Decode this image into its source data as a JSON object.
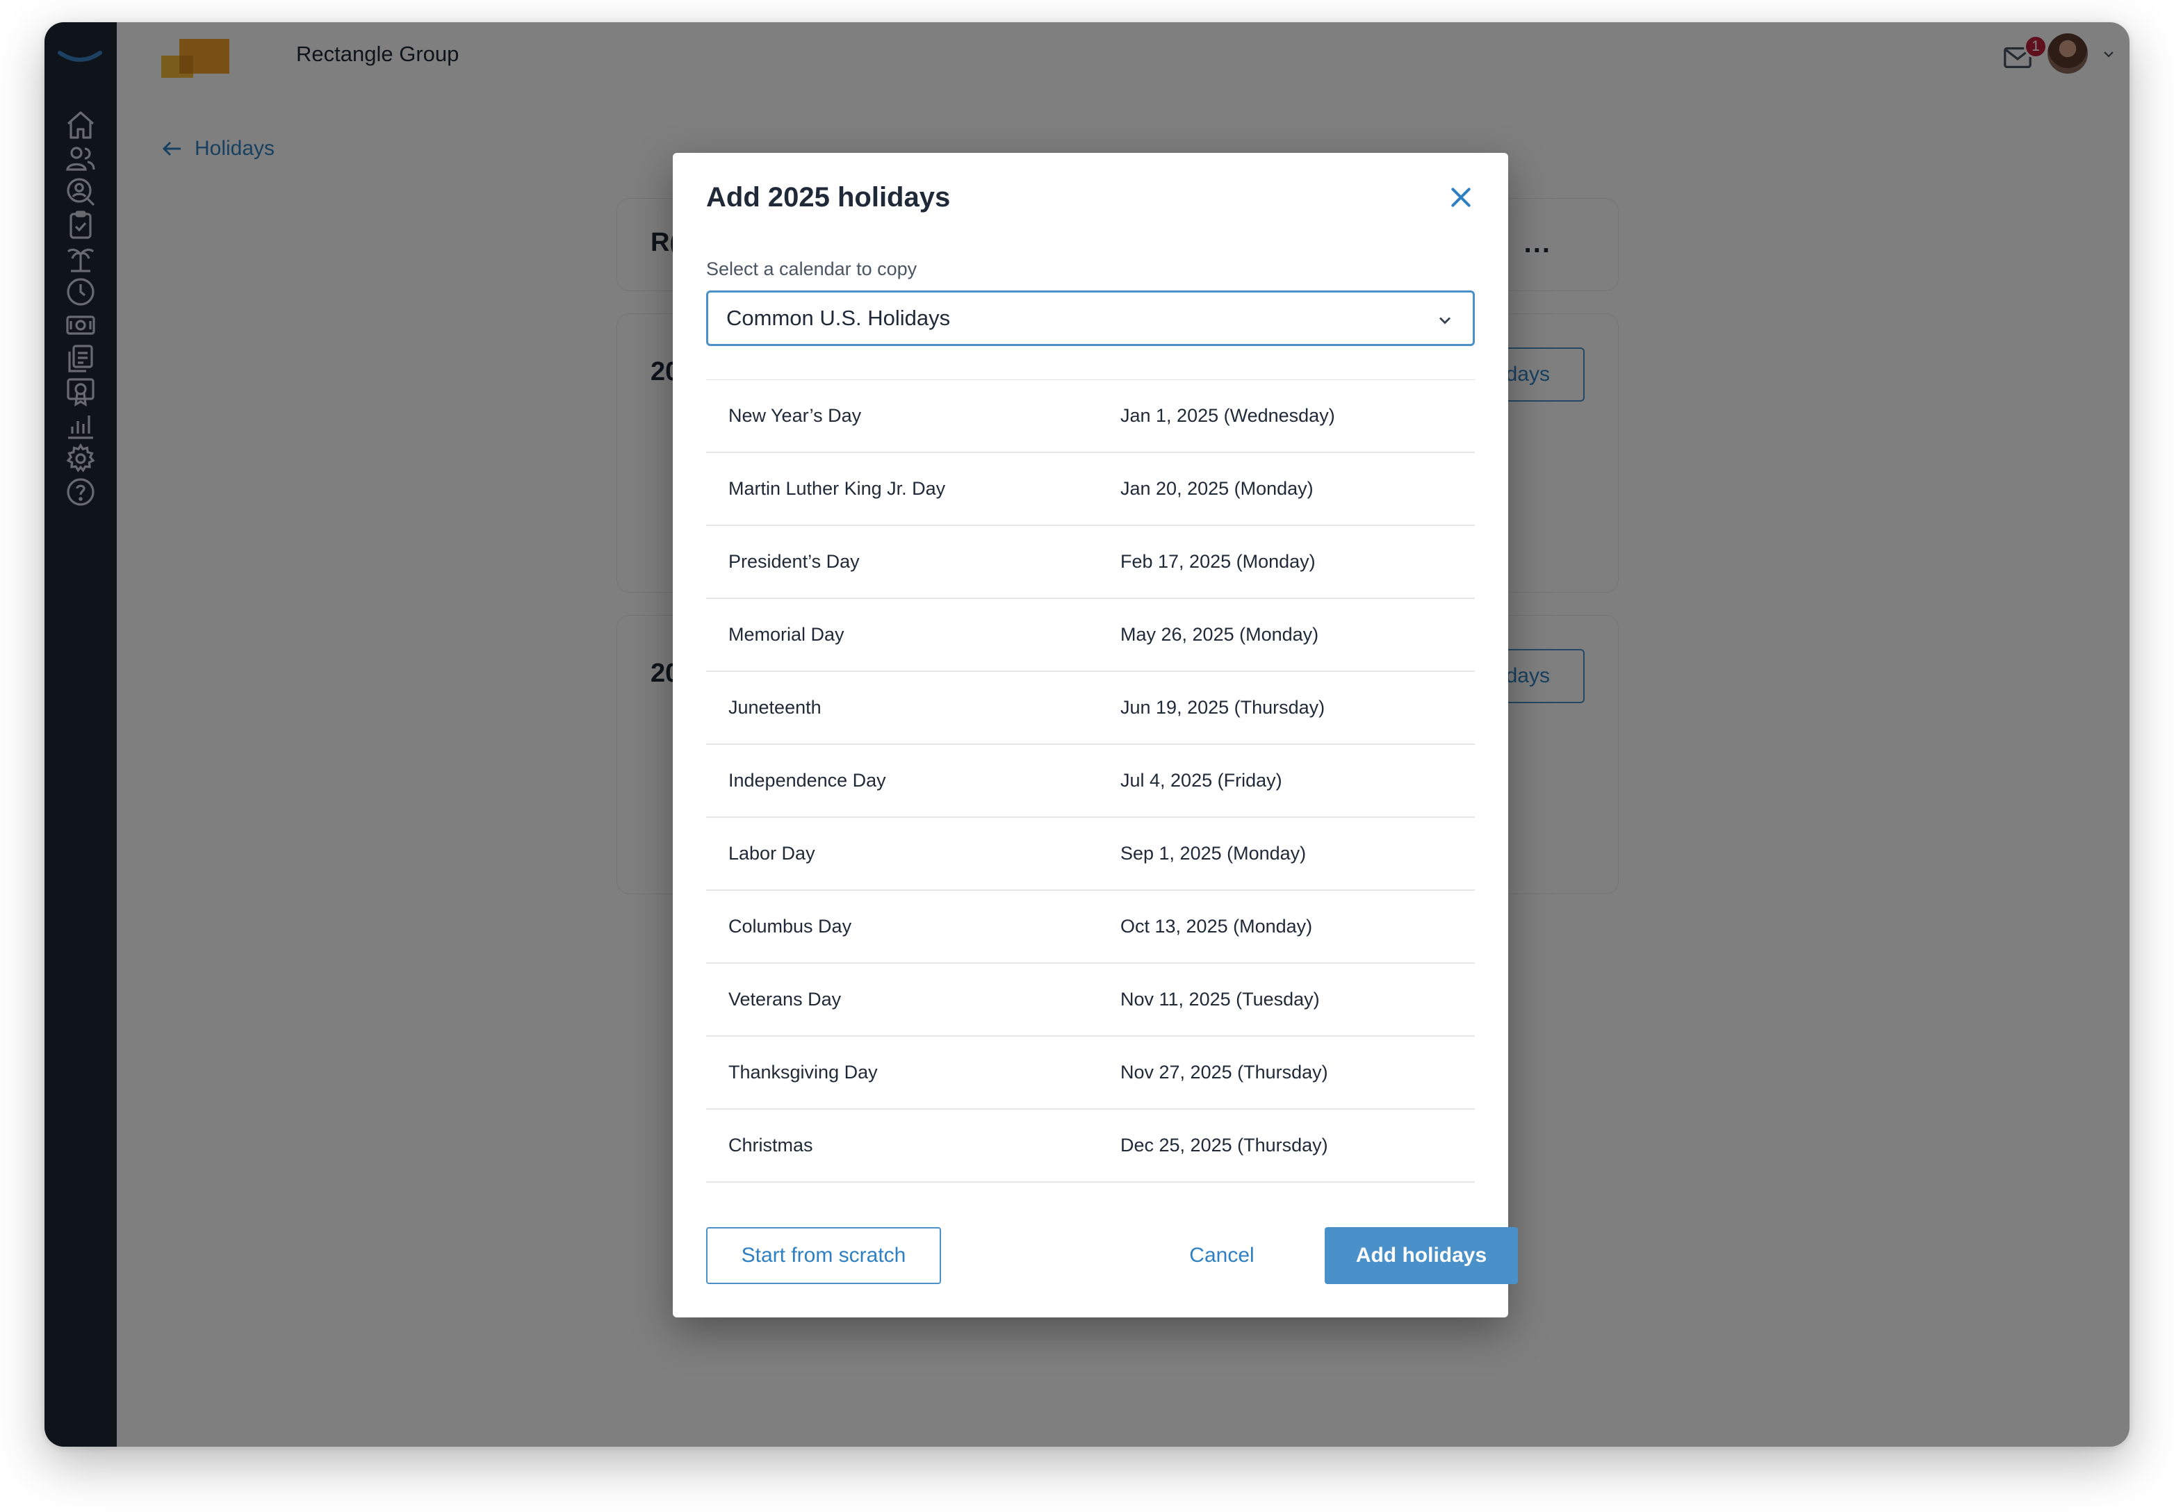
{
  "header": {
    "company_name": "Rectangle Group",
    "notification_count": "1",
    "brand_icon": "brand-swoosh",
    "mail_icon": "mail-icon",
    "avatar_icon": "user-avatar"
  },
  "sidebar": {
    "items": [
      {
        "icon": "home-icon"
      },
      {
        "icon": "people-icon"
      },
      {
        "icon": "person-search-icon"
      },
      {
        "icon": "clipboard-check-icon"
      },
      {
        "icon": "palm-tree-icon"
      },
      {
        "icon": "clock-icon"
      },
      {
        "icon": "money-icon"
      },
      {
        "icon": "documents-icon"
      },
      {
        "icon": "certificate-icon"
      },
      {
        "icon": "bar-chart-icon"
      },
      {
        "icon": "gear-icon"
      },
      {
        "icon": "help-icon"
      }
    ]
  },
  "page": {
    "back_link": "Holidays",
    "cards": [
      {
        "title_fragment": "R(",
        "dots": "..."
      },
      {
        "title_fragment": "20",
        "button_fragment": "days"
      },
      {
        "title_fragment": "20",
        "button_fragment": "days"
      }
    ]
  },
  "modal": {
    "title": "Add 2025 holidays",
    "select_label": "Select a calendar to copy",
    "selected_calendar": "Common U.S. Holidays",
    "holidays": [
      {
        "name": "New Year’s Day",
        "date": "Jan 1, 2025 (Wednesday)"
      },
      {
        "name": "Martin Luther King Jr. Day",
        "date": "Jan 20, 2025 (Monday)"
      },
      {
        "name": "President’s Day",
        "date": "Feb 17, 2025 (Monday)"
      },
      {
        "name": "Memorial Day",
        "date": "May 26, 2025 (Monday)"
      },
      {
        "name": "Juneteenth",
        "date": "Jun 19, 2025 (Thursday)"
      },
      {
        "name": "Independence Day",
        "date": "Jul 4, 2025 (Friday)"
      },
      {
        "name": "Labor Day",
        "date": "Sep 1, 2025 (Monday)"
      },
      {
        "name": "Columbus Day",
        "date": "Oct 13, 2025 (Monday)"
      },
      {
        "name": "Veterans Day",
        "date": "Nov 11, 2025 (Tuesday)"
      },
      {
        "name": "Thanksgiving Day",
        "date": "Nov 27, 2025 (Thursday)"
      },
      {
        "name": "Christmas",
        "date": "Dec 25, 2025 (Thursday)"
      }
    ],
    "buttons": {
      "scratch": "Start from scratch",
      "cancel": "Cancel",
      "add": "Add holidays"
    }
  },
  "colors": {
    "sidebar": "#1f2937",
    "accent": "#4a90c9",
    "badge": "#c0213a",
    "overlay": "rgba(0,0,0,0.5)"
  }
}
